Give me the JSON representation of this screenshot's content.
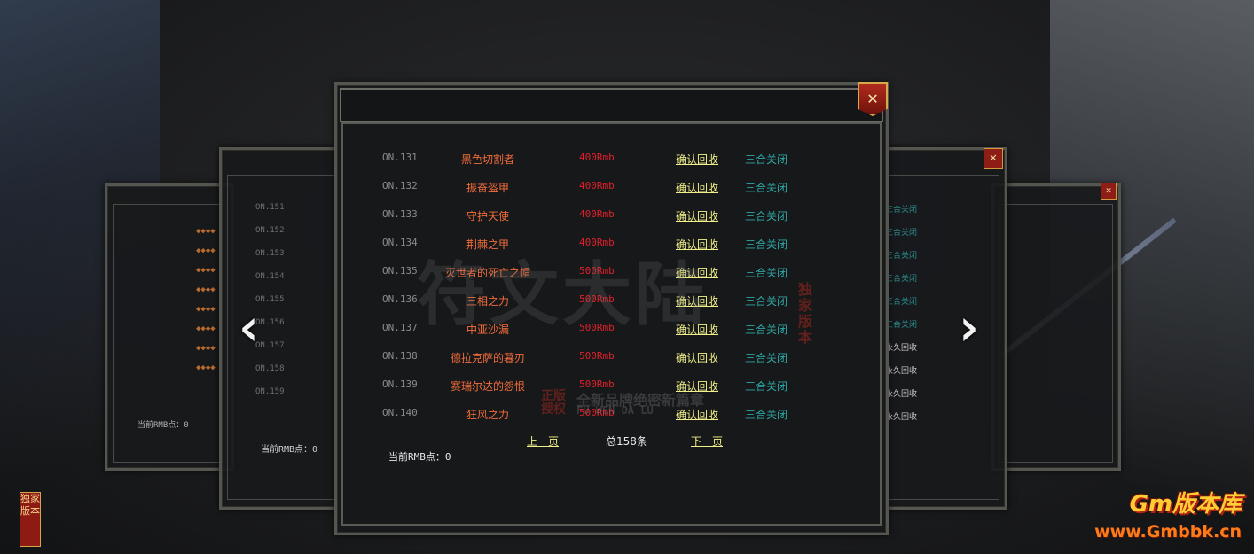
{
  "main_panel": {
    "rows": [
      {
        "no": "ON.131",
        "name": "黑色切割者",
        "price": "400Rmb",
        "confirm": "确认回收",
        "status": "三合关闭"
      },
      {
        "no": "ON.132",
        "name": "振奋盔甲",
        "price": "400Rmb",
        "confirm": "确认回收",
        "status": "三合关闭"
      },
      {
        "no": "ON.133",
        "name": "守护天使",
        "price": "400Rmb",
        "confirm": "确认回收",
        "status": "三合关闭"
      },
      {
        "no": "ON.134",
        "name": "荆棘之甲",
        "price": "400Rmb",
        "confirm": "确认回收",
        "status": "三合关闭"
      },
      {
        "no": "ON.135",
        "name": "灭世者的死亡之帽",
        "price": "500Rmb",
        "confirm": "确认回收",
        "status": "三合关闭"
      },
      {
        "no": "ON.136",
        "name": "三相之力",
        "price": "500Rmb",
        "confirm": "确认回收",
        "status": "三合关闭"
      },
      {
        "no": "ON.137",
        "name": "中亚沙漏",
        "price": "500Rmb",
        "confirm": "确认回收",
        "status": "三合关闭"
      },
      {
        "no": "ON.138",
        "name": "德拉克萨的暮刃",
        "price": "500Rmb",
        "confirm": "确认回收",
        "status": "三合关闭"
      },
      {
        "no": "ON.139",
        "name": "赛瑞尔达的怨恨",
        "price": "500Rmb",
        "confirm": "确认回收",
        "status": "三合关闭"
      },
      {
        "no": "ON.140",
        "name": "狂风之力",
        "price": "500Rmb",
        "confirm": "确认回收",
        "status": "三合关闭"
      }
    ],
    "pager": {
      "prev": "上一页",
      "total": "总158条",
      "next": "下一页"
    },
    "rmb": "当前RMB点：0",
    "close_glyph": "✕"
  },
  "left_panel": {
    "nos": [
      "ON.151",
      "ON.152",
      "ON.153",
      "ON.154",
      "ON.155",
      "ON.156",
      "ON.157",
      "ON.158",
      "ON.159"
    ],
    "rmb": "当前RMB点：0"
  },
  "far_left_panel": {
    "rmb": "当前RMB点：0"
  },
  "right_panel": {
    "statuses": [
      "三合关闭",
      "三合关闭",
      "三合关闭",
      "三合关闭",
      "三合关闭",
      "三合关闭",
      "永久回收",
      "永久回收",
      "永久回收",
      "永久回收"
    ],
    "close_glyph": "✕"
  },
  "nav": {
    "left_arrow": "‹",
    "right_arrow": "›"
  },
  "watermark": {
    "title": "符文大陆",
    "subtitle": "全新品牌绝密新篇章",
    "latin": "FU WEN DA LU",
    "tag": "独家版本",
    "seal": "正版授权"
  },
  "badge_left": "独家版本",
  "logo": {
    "brand": "Gm版本库",
    "url": "www.Gmbbk.cn"
  },
  "colors": {
    "accent_red": "#8e1d16",
    "gold": "#d6a94a",
    "name_orange": "#f26d3b",
    "price_red": "#e0202a",
    "link_yellow": "#f1f08a",
    "status_cyan": "#2ea7a4"
  }
}
